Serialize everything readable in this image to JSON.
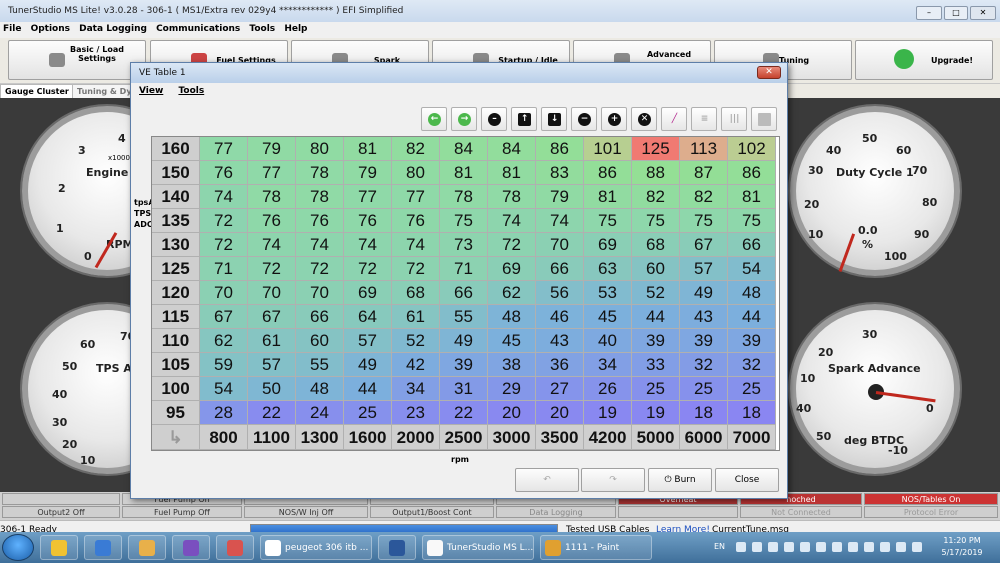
{
  "main_window": {
    "title": "TunerStudio MS Lite! v3.0.28 - 306-1 ( MS1/Extra rev 029y4 ************ ) EFI Simplified",
    "controls": {
      "minimize": "–",
      "maximize": "□",
      "close": "✕"
    }
  },
  "menu": [
    "File",
    "Options",
    "Data Logging",
    "Communications",
    "Tools",
    "Help"
  ],
  "toolbar": [
    {
      "label": "Basic / Load Settings",
      "icon": "gear-icon"
    },
    {
      "label": "Fuel Settings",
      "icon": "fuel-icon"
    },
    {
      "label": "Spark",
      "icon": "spark-plug-icon"
    },
    {
      "label": "Startup / Idle",
      "icon": "startup-icon"
    },
    {
      "label": "Advanced",
      "icon": "gear-icon"
    },
    {
      "label": "Tuning",
      "icon": "wrench-icon"
    },
    {
      "label": "Upgrade!",
      "icon": "upgrade-arrow-icon"
    }
  ],
  "tabs": [
    "Gauge Cluster",
    "Tuning & Dyn"
  ],
  "gauges": {
    "rpm": {
      "label": "Engine R",
      "sub": "RPM",
      "multiplier": "x1000",
      "ticks": [
        "4",
        "3",
        "2",
        "1",
        "0"
      ]
    },
    "duty": {
      "label": "Duty Cycle 1",
      "value": "0.0",
      "unit": "%",
      "ticks": [
        "50",
        "60",
        "40",
        "70",
        "30",
        "80",
        "20",
        "90",
        "10",
        "100"
      ]
    },
    "tps": {
      "label": "TPS AD",
      "ticks": [
        "70",
        "60",
        "50",
        "40",
        "30",
        "20",
        "10"
      ]
    },
    "spark": {
      "label": "Spark Advance",
      "unit": "deg BTDC",
      "ticks": [
        "30",
        "20",
        "10",
        "40",
        "0",
        "50",
        "-10"
      ]
    }
  },
  "indicators": {
    "row1": [
      "",
      "Fuel Pump On",
      "",
      "",
      "",
      "Overheat",
      "noched",
      "NOS/Tables On"
    ],
    "row2": [
      "Output2 Off",
      "Fuel Pump Off",
      "NOS/W Inj Off",
      "Output1/Boost Cont",
      "Data Logging",
      "",
      "Not Connected",
      "Protocol Error"
    ]
  },
  "statusbar": {
    "left": "306-1 Ready",
    "tested": "Tested USB Cables",
    "learn": "Learn More!",
    "tune": "CurrentTune.msq"
  },
  "ve_dialog": {
    "title": "VE Table 1",
    "menu": [
      "View",
      "Tools"
    ],
    "ylabel": "tpsADC TPS ADC",
    "xlabel": "rpm",
    "buttons": {
      "burn": "Burn",
      "close": "Close"
    },
    "icons": [
      "green-back-icon",
      "green-forward-icon",
      "minus-icon",
      "up-arrow-icon",
      "down-arrow-icon",
      "decrement-icon",
      "increment-icon",
      "cancel-icon",
      "pen-icon",
      "rows-icon",
      "columns-icon",
      "square-icon"
    ],
    "rows": [
      "160",
      "150",
      "140",
      "135",
      "130",
      "125",
      "120",
      "115",
      "110",
      "105",
      "100",
      "95"
    ],
    "cols": [
      "800",
      "1100",
      "1300",
      "1600",
      "2000",
      "2500",
      "3000",
      "3500",
      "4200",
      "5000",
      "6000",
      "7000"
    ],
    "values": [
      [
        "77",
        "79",
        "80",
        "81",
        "82",
        "84",
        "84",
        "86",
        "101",
        "125",
        "113",
        "102"
      ],
      [
        "76",
        "77",
        "78",
        "79",
        "80",
        "81",
        "81",
        "83",
        "86",
        "88",
        "87",
        "86"
      ],
      [
        "74",
        "78",
        "78",
        "77",
        "77",
        "78",
        "78",
        "79",
        "81",
        "82",
        "82",
        "81"
      ],
      [
        "72",
        "76",
        "76",
        "76",
        "76",
        "75",
        "74",
        "74",
        "75",
        "75",
        "75",
        "75"
      ],
      [
        "72",
        "74",
        "74",
        "74",
        "74",
        "73",
        "72",
        "70",
        "69",
        "68",
        "67",
        "66"
      ],
      [
        "71",
        "72",
        "72",
        "72",
        "72",
        "71",
        "69",
        "66",
        "63",
        "60",
        "57",
        "54"
      ],
      [
        "70",
        "70",
        "70",
        "69",
        "68",
        "66",
        "62",
        "56",
        "53",
        "52",
        "49",
        "48"
      ],
      [
        "67",
        "67",
        "66",
        "64",
        "61",
        "55",
        "48",
        "46",
        "45",
        "44",
        "43",
        "44"
      ],
      [
        "62",
        "61",
        "60",
        "57",
        "52",
        "49",
        "45",
        "43",
        "40",
        "39",
        "39",
        "39"
      ],
      [
        "59",
        "57",
        "55",
        "49",
        "42",
        "39",
        "38",
        "36",
        "34",
        "33",
        "32",
        "32"
      ],
      [
        "54",
        "50",
        "48",
        "44",
        "34",
        "31",
        "29",
        "27",
        "26",
        "25",
        "25",
        "25"
      ],
      [
        "28",
        "22",
        "24",
        "25",
        "23",
        "22",
        "20",
        "20",
        "19",
        "19",
        "18",
        "18"
      ]
    ]
  },
  "taskbar": {
    "items": [
      {
        "label": "",
        "icon": "file-explorer-icon"
      },
      {
        "label": "",
        "icon": "internet-explorer-icon"
      },
      {
        "label": "",
        "icon": "folder-icon"
      },
      {
        "label": "",
        "icon": "visual-studio-icon"
      },
      {
        "label": "",
        "icon": "media-player-icon"
      },
      {
        "label": "peugeot 306 itb ...",
        "icon": "chrome-icon"
      },
      {
        "label": "",
        "icon": "word-icon"
      },
      {
        "label": "TunerStudio MS L...",
        "icon": "tunerstudio-icon"
      },
      {
        "label": "1111 - Paint",
        "icon": "paint-icon"
      }
    ],
    "lang": "EN",
    "time": "11:20 PM",
    "date": "5/17/2019"
  },
  "colors": {
    "low": "#8a86f2",
    "mid": "#8fd9a8",
    "high": "#f07a72"
  }
}
